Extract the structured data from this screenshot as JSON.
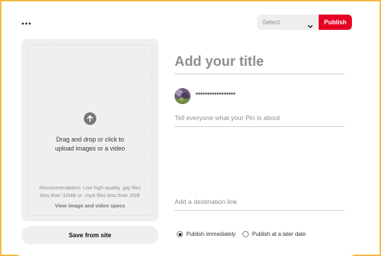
{
  "toolbar": {
    "more_icon": "more-options-icon",
    "board_select": {
      "value": "Select",
      "icon": "chevron-down-icon"
    },
    "publish_label": "Publish",
    "publish_color": "#e60023"
  },
  "upload": {
    "icon": "arrow-up-circle-icon",
    "instruction_line1": "Drag and drop or click to",
    "instruction_line2": "upload images or a video",
    "recommendation_line1": "Recommendation: Use high-quality .jpg files",
    "recommendation_line2": "less than 32MB or .mp4 files less than 2GB",
    "specs_link": "View image and video specs"
  },
  "save_from_site_label": "Save from site",
  "pin": {
    "title_placeholder": "Add your title",
    "username": "*****************",
    "description_placeholder": "Tell everyone what your Pin is about",
    "link_placeholder": "Add a destination link"
  },
  "publish_options": [
    {
      "label": "Publish immediately",
      "checked": true
    },
    {
      "label": "Publish at a later date",
      "checked": false
    }
  ],
  "colors": {
    "frame_border": "#f3b83c",
    "panel_bg": "#efefef"
  }
}
